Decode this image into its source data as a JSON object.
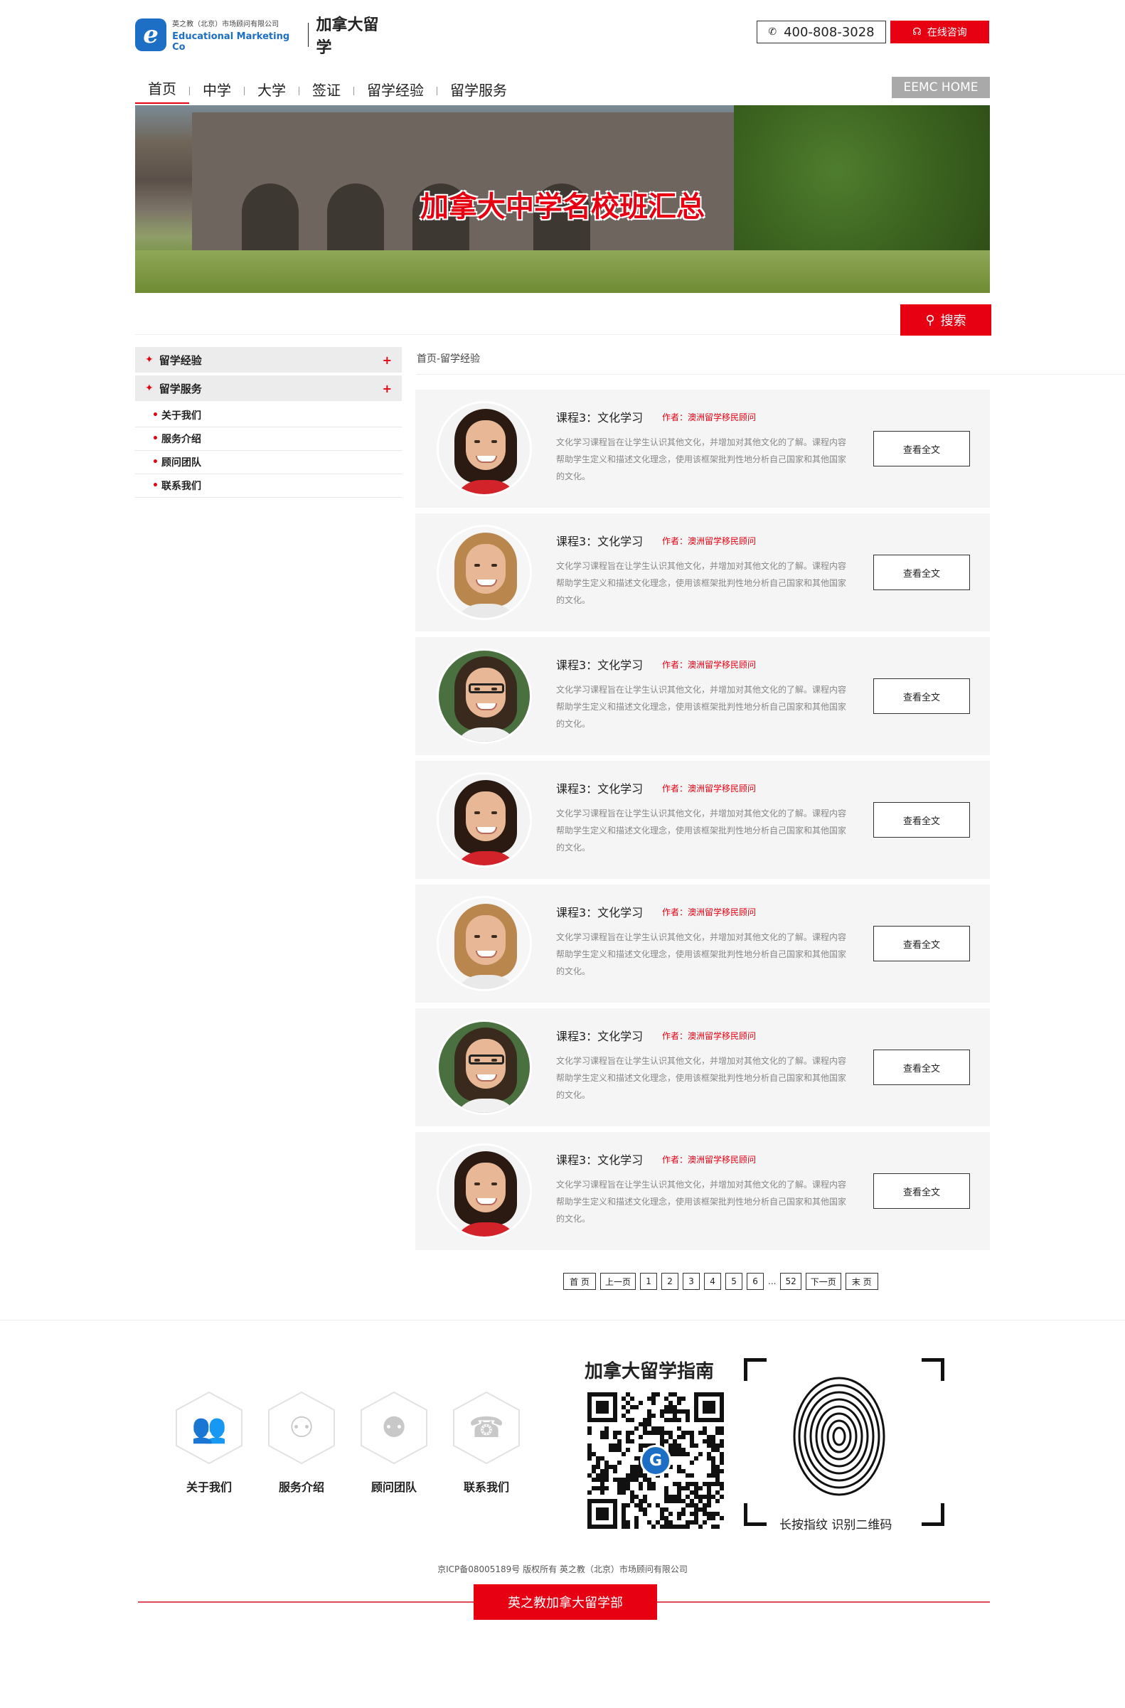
{
  "header": {
    "logo_letter": "e",
    "logo_company_cn": "英之教（北京）市场顾问有限公司",
    "logo_company_en": "Educational Marketing Co",
    "site_title": "加拿大留学",
    "phone": "400-808-3028",
    "consult_label": "在线咨询"
  },
  "nav": {
    "items": [
      "首页",
      "中学",
      "大学",
      "签证",
      "留学经验",
      "留学服务"
    ],
    "active": "首页",
    "home_link": "EEMC HOME"
  },
  "banner": {
    "title": "加拿大中学名校班汇总"
  },
  "search": {
    "button_label": "搜索"
  },
  "sidebar": {
    "sections": [
      {
        "label": "留学经验",
        "toggle": "+"
      },
      {
        "label": "留学服务",
        "toggle": "+"
      }
    ],
    "sub_items": [
      "关于我们",
      "服务介绍",
      "顾问团队",
      "联系我们"
    ]
  },
  "breadcrumb": "首页-留学经验",
  "articles": [
    {
      "title": "课程3：文化学习",
      "author_label": "作者：",
      "author": "澳洲留学移民顾问",
      "desc": "文化学习课程旨在让学生认识其他文化，并增加对其他文化的了解。课程内容帮助学生定义和描述文化理念，使用该框架批判性地分析自己国家和其他国家的文化。",
      "button": "查看全文",
      "avatar": "woman-dark-hair"
    },
    {
      "title": "课程3：文化学习",
      "author_label": "作者：",
      "author": "澳洲留学移民顾问",
      "desc": "文化学习课程旨在让学生认识其他文化，并增加对其他文化的了解。课程内容帮助学生定义和描述文化理念，使用该框架批判性地分析自己国家和其他国家的文化。",
      "button": "查看全文",
      "avatar": "woman-blonde"
    },
    {
      "title": "课程3：文化学习",
      "author_label": "作者：",
      "author": "澳洲留学移民顾问",
      "desc": "文化学习课程旨在让学生认识其他文化，并增加对其他文化的了解。课程内容帮助学生定义和描述文化理念，使用该框架批判性地分析自己国家和其他国家的文化。",
      "button": "查看全文",
      "avatar": "man-glasses"
    },
    {
      "title": "课程3：文化学习",
      "author_label": "作者：",
      "author": "澳洲留学移民顾问",
      "desc": "文化学习课程旨在让学生认识其他文化，并增加对其他文化的了解。课程内容帮助学生定义和描述文化理念，使用该框架批判性地分析自己国家和其他国家的文化。",
      "button": "查看全文",
      "avatar": "woman-dark-hair"
    },
    {
      "title": "课程3：文化学习",
      "author_label": "作者：",
      "author": "澳洲留学移民顾问",
      "desc": "文化学习课程旨在让学生认识其他文化，并增加对其他文化的了解。课程内容帮助学生定义和描述文化理念，使用该框架批判性地分析自己国家和其他国家的文化。",
      "button": "查看全文",
      "avatar": "woman-blonde"
    },
    {
      "title": "课程3：文化学习",
      "author_label": "作者：",
      "author": "澳洲留学移民顾问",
      "desc": "文化学习课程旨在让学生认识其他文化，并增加对其他文化的了解。课程内容帮助学生定义和描述文化理念，使用该框架批判性地分析自己国家和其他国家的文化。",
      "button": "查看全文",
      "avatar": "man-glasses"
    },
    {
      "title": "课程3：文化学习",
      "author_label": "作者：",
      "author": "澳洲留学移民顾问",
      "desc": "文化学习课程旨在让学生认识其他文化，并增加对其他文化的了解。课程内容帮助学生定义和描述文化理念，使用该框架批判性地分析自己国家和其他国家的文化。",
      "button": "查看全文",
      "avatar": "woman-dark-hair"
    }
  ],
  "pagination": {
    "first": "首 页",
    "prev": "上一页",
    "pages": [
      "1",
      "2",
      "3",
      "4",
      "5",
      "6"
    ],
    "ellipsis": "...",
    "last_page": "52",
    "next": "下一页",
    "end": "末 页"
  },
  "footer": {
    "icons": [
      {
        "label": "关于我们",
        "icon": "people-icon"
      },
      {
        "label": "服务介绍",
        "icon": "meeting-icon"
      },
      {
        "label": "顾问团队",
        "icon": "team-icon"
      },
      {
        "label": "联系我们",
        "icon": "phone-icon"
      }
    ],
    "guide_title": "加拿大留学指南",
    "qr_logo_letter": "G",
    "fingerprint_label": "长按指纹 识别二维码",
    "copyright": "京ICP备08005189号 版权所有 英之教（北京）市场顾问有限公司",
    "badge": "英之教加拿大留学部"
  },
  "colors": {
    "accent": "#e60012",
    "brand_blue": "#1c6fc4",
    "card_bg": "#f5f5f5"
  }
}
